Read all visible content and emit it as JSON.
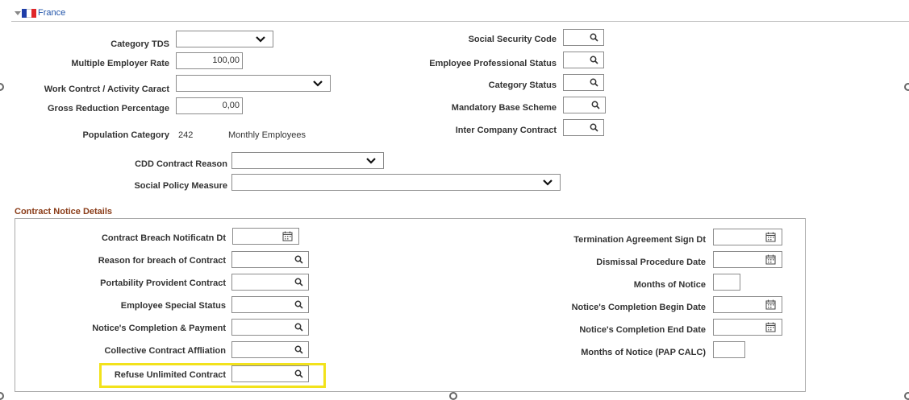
{
  "section": {
    "title": "France",
    "flag_colors": [
      "#1f3ea8",
      "#ffffff",
      "#e0272a"
    ]
  },
  "fields_left": {
    "category_tds": {
      "label": "Category TDS",
      "value": ""
    },
    "multiple_employer_rate": {
      "label": "Multiple Employer Rate",
      "value": "100,00"
    },
    "work_contract": {
      "label": "Work Contrct / Activity Caract",
      "value": ""
    },
    "gross_reduction": {
      "label": "Gross Reduction Percentage",
      "value": "0,00"
    },
    "population_category": {
      "label": "Population Category",
      "code": "242",
      "description": "Monthly Employees"
    },
    "cdd_reason": {
      "label": "CDD Contract Reason",
      "value": ""
    },
    "social_policy": {
      "label": "Social Policy Measure",
      "value": ""
    }
  },
  "fields_right": {
    "social_security_code": {
      "label": "Social Security Code",
      "value": ""
    },
    "employee_prof_status": {
      "label": "Employee Professional Status",
      "value": ""
    },
    "category_status": {
      "label": "Category Status",
      "value": ""
    },
    "mandatory_base_scheme": {
      "label": "Mandatory Base Scheme",
      "value": ""
    },
    "inter_company_contract": {
      "label": "Inter Company Contract",
      "value": ""
    }
  },
  "notice": {
    "title": "Contract Notice Details",
    "left": [
      {
        "label": "Contract Breach Notificatn Dt",
        "type": "date",
        "value": ""
      },
      {
        "label": "Reason for breach of Contract",
        "type": "prompt",
        "value": ""
      },
      {
        "label": "Portability Provident Contract",
        "type": "prompt",
        "value": ""
      },
      {
        "label": "Employee Special Status",
        "type": "prompt",
        "value": ""
      },
      {
        "label": "Notice's Completion & Payment",
        "type": "prompt",
        "value": ""
      },
      {
        "label": "Collective Contract Affliation",
        "type": "prompt",
        "value": ""
      },
      {
        "label": "Refuse Unlimited Contract",
        "type": "prompt",
        "value": ""
      }
    ],
    "right": [
      {
        "label": "Termination Agreement Sign Dt",
        "type": "date",
        "value": ""
      },
      {
        "label": "Dismissal Procedure Date",
        "type": "date",
        "value": ""
      },
      {
        "label": "Months of Notice",
        "type": "text",
        "value": ""
      },
      {
        "label": "Notice's Completion Begin Date",
        "type": "date",
        "value": ""
      },
      {
        "label": "Notice's Completion End Date",
        "type": "date",
        "value": ""
      },
      {
        "label": "Months of Notice (PAP CALC)",
        "type": "text",
        "value": ""
      }
    ]
  },
  "colors": {
    "section_title": "#2255aa",
    "notice_title": "#8a3c18",
    "highlight": "#f2e21b"
  }
}
